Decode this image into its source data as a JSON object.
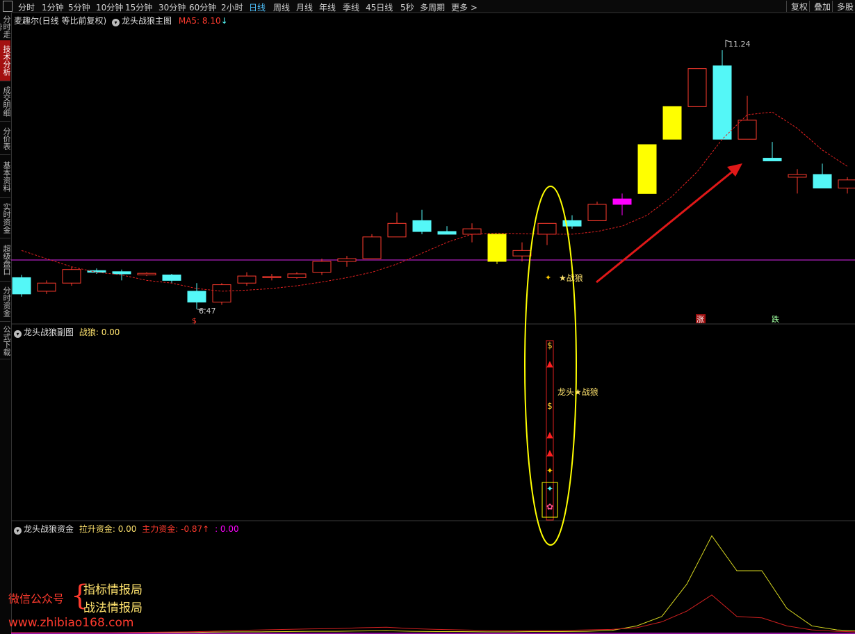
{
  "toolbar": {
    "periods": [
      "分时",
      "1分钟",
      "5分钟",
      "10分钟",
      "15分钟",
      "30分钟",
      "60分钟",
      "2小时",
      "日线",
      "周线",
      "月线",
      "年线",
      "季线",
      "45日线",
      "5秒",
      "多周期",
      "更多 >"
    ],
    "active_period": "日线",
    "right_buttons": [
      "复权",
      "叠加",
      "多股"
    ]
  },
  "sidebar": {
    "tabs": [
      "分时走势",
      "技术分析",
      "成交明细",
      "分价表",
      "基本资料",
      "实时资金",
      "超级盘口",
      "分时资金",
      "公式下载"
    ],
    "active": "技术分析"
  },
  "main_panel": {
    "stock": "麦趣尔(日线 等比前复权)",
    "indicator": "龙头战狼主图",
    "ma_label": "MA5: 8.10",
    "ma_arrow": "↓",
    "high_label": "11.24",
    "low_label": "6.47",
    "signal_text": "★战狼",
    "zhang": "涨",
    "die": "跌",
    "buy_mark": "$"
  },
  "sub_panel": {
    "title": "龙头战狼副图",
    "value_label": "战狼: 0.00",
    "signal_text": "龙头★战狼"
  },
  "fund_panel": {
    "title": "龙头战狼资金",
    "lift_label": "拉升资金: 0.00",
    "main_label": "主力资金: -0.87",
    "main_arrow": "↑",
    "third_label": ": 0.00"
  },
  "promo": {
    "label": "微信公众号",
    "line1": "指标情报局",
    "line2": "战法情报局",
    "url": "www.zhibiao168.com"
  },
  "colors": {
    "up": "#ff3b2e",
    "down": "#54f7f7",
    "yellow": "#ffff00",
    "magenta": "#ff00ff",
    "ma": "#e02020",
    "baseline": "#b020c0"
  },
  "chart_data": [
    {
      "type": "candlestick",
      "title": "龙头战狼主图",
      "series": [
        {
          "name": "K线",
          "ohlc": [
            [
              7.05,
              7.1,
              6.7,
              6.75
            ],
            [
              6.8,
              7.0,
              6.75,
              6.95
            ],
            [
              6.95,
              7.25,
              6.9,
              7.2
            ],
            [
              7.18,
              7.22,
              7.12,
              7.15
            ],
            [
              7.16,
              7.2,
              7.0,
              7.12
            ],
            [
              7.1,
              7.15,
              7.08,
              7.13
            ],
            [
              7.1,
              7.12,
              6.95,
              7.0
            ],
            [
              6.8,
              6.95,
              6.47,
              6.6
            ],
            [
              6.6,
              6.95,
              6.55,
              6.92
            ],
            [
              6.95,
              7.15,
              6.9,
              7.08
            ],
            [
              7.05,
              7.12,
              7.0,
              7.07
            ],
            [
              7.05,
              7.15,
              7.03,
              7.12
            ],
            [
              7.15,
              7.4,
              7.1,
              7.35
            ],
            [
              7.35,
              7.45,
              7.25,
              7.4
            ],
            [
              7.4,
              7.85,
              7.4,
              7.8
            ],
            [
              7.8,
              8.25,
              7.8,
              8.05
            ],
            [
              8.1,
              8.3,
              7.85,
              7.9
            ],
            [
              7.9,
              8.0,
              7.85,
              7.85
            ],
            [
              7.85,
              8.05,
              7.7,
              7.95
            ],
            [
              7.85,
              7.85,
              7.3,
              7.35
            ],
            [
              7.45,
              7.7,
              7.35,
              7.55
            ],
            [
              7.85,
              8.05,
              7.65,
              8.05
            ],
            [
              8.1,
              8.2,
              7.95,
              8.0
            ],
            [
              8.1,
              8.45,
              8.1,
              8.4
            ],
            [
              8.4,
              8.6,
              8.2,
              8.5
            ],
            [
              8.6,
              9.5,
              8.6,
              9.5
            ],
            [
              9.6,
              10.2,
              9.6,
              10.2
            ],
            [
              10.2,
              10.9,
              10.2,
              10.9
            ],
            [
              10.95,
              11.24,
              9.6,
              9.6
            ],
            [
              9.6,
              10.4,
              9.6,
              9.95
            ],
            [
              9.25,
              9.55,
              9.2,
              9.2
            ],
            [
              8.9,
              9.05,
              8.6,
              8.95
            ],
            [
              8.95,
              9.15,
              8.7,
              8.7
            ],
            [
              8.7,
              8.9,
              8.6,
              8.85
            ]
          ]
        },
        {
          "name": "MA5",
          "values": [
            7.55,
            7.4,
            7.25,
            7.15,
            7.1,
            7.0,
            6.95,
            6.85,
            6.8,
            6.82,
            6.85,
            6.9,
            6.97,
            7.05,
            7.15,
            7.3,
            7.5,
            7.7,
            7.85,
            7.87,
            7.86,
            7.85,
            7.85,
            7.9,
            8.0,
            8.2,
            8.55,
            9.0,
            9.6,
            10.05,
            10.1,
            9.8,
            9.4,
            9.1
          ]
        }
      ],
      "xlabel": "",
      "ylabel": "",
      "ylim": [
        6.3,
        11.6
      ],
      "grid": false,
      "annotations": [
        "11.24",
        "6.47",
        "★战狼",
        "涨",
        "跌"
      ]
    },
    {
      "type": "line",
      "title": "龙头战狼资金",
      "series": [
        {
          "name": "拉升资金",
          "values": [
            0,
            0,
            0,
            0,
            0,
            0,
            0,
            0,
            0.02,
            0.03,
            0.03,
            0.04,
            0.05,
            0.05,
            0.06,
            0.07,
            0.05,
            0.04,
            0.04,
            0.03,
            0.03,
            0.04,
            0.04,
            0.05,
            0.08,
            0.25,
            0.6,
            1.8,
            3.6,
            2.3,
            2.3,
            0.9,
            0.25,
            0.1,
            0.05
          ]
        },
        {
          "name": "主力资金",
          "values": [
            0,
            0,
            0,
            0,
            0,
            0.01,
            0.02,
            0.03,
            0.05,
            0.08,
            0.1,
            0.12,
            0.14,
            0.15,
            0.18,
            0.2,
            0.15,
            0.12,
            0.1,
            0.08,
            0.07,
            0.08,
            0.08,
            0.1,
            0.12,
            0.18,
            0.4,
            0.8,
            1.4,
            0.6,
            0.55,
            0.25,
            0.1,
            0.05,
            0.02
          ]
        }
      ],
      "xlabel": "",
      "ylabel": "",
      "ylim": [
        0,
        3.8
      ],
      "grid": false
    }
  ]
}
